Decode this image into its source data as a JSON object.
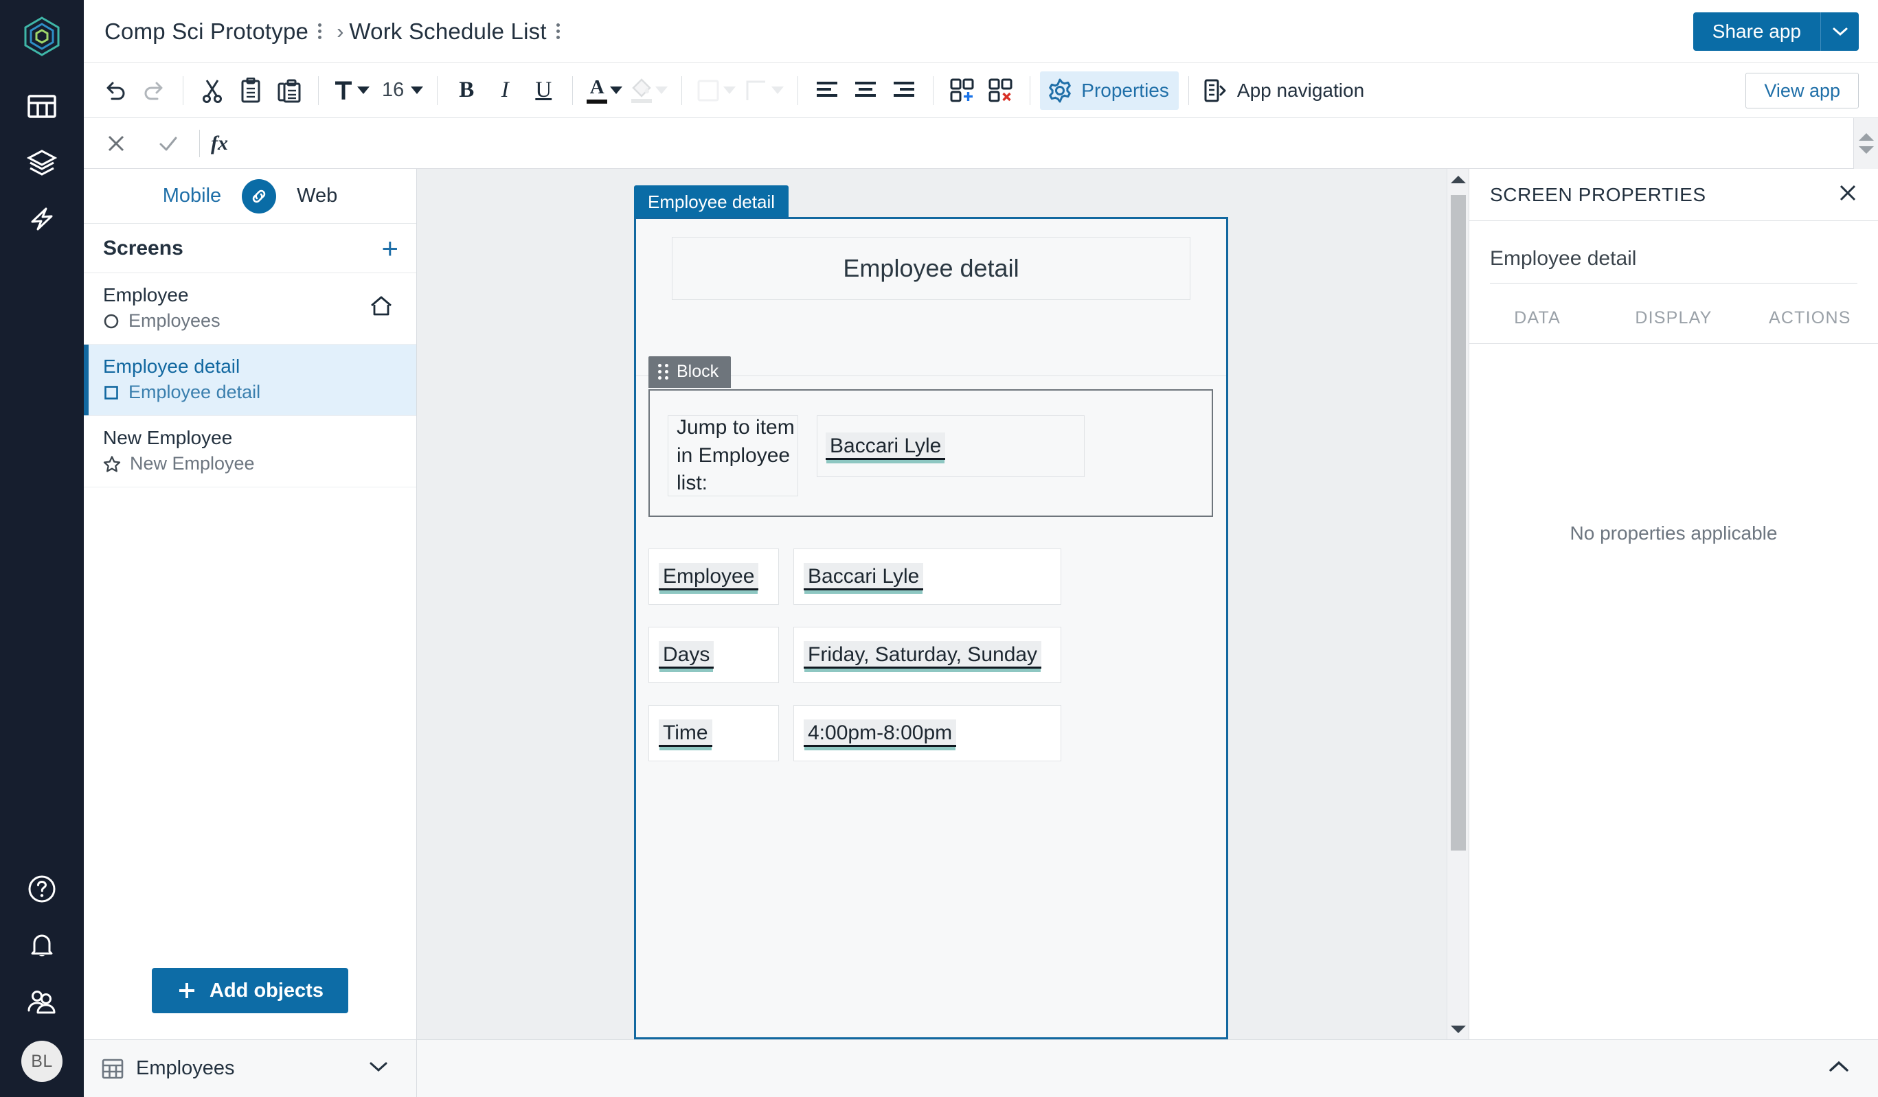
{
  "app": {
    "logo_icon": "appsheet-hex-logo"
  },
  "header": {
    "breadcrumb": [
      {
        "label": "Comp Sci Prototype",
        "menu_icon": "kebab-menu-icon"
      },
      {
        "label": "Work Schedule List",
        "menu_icon": "kebab-menu-icon"
      }
    ],
    "separator": "›",
    "share_label": "Share app",
    "share_caret_icon": "chevron-down-icon"
  },
  "rail": {
    "items": [
      {
        "name": "data",
        "icon": "table-grid-icon"
      },
      {
        "name": "app",
        "icon": "layers-stack-icon"
      },
      {
        "name": "automation",
        "icon": "lightning-bolt-icon"
      }
    ],
    "bottom_items": [
      {
        "name": "help",
        "icon": "question-circle-icon"
      },
      {
        "name": "notifications",
        "icon": "bell-icon"
      },
      {
        "name": "team",
        "icon": "users-icon"
      }
    ],
    "avatar_initials": "BL"
  },
  "toolbar": {
    "undo_icon": "undo-icon",
    "redo_icon": "redo-icon",
    "cut_icon": "scissors-icon",
    "copy_icon": "clipboard-icon",
    "paste_icon": "clipboard-paste-icon",
    "font_icon": "text-format-icon",
    "font_size": "16",
    "bold_label": "B",
    "italic_label": "I",
    "underline_label": "U",
    "text_color_label": "A",
    "fill_icon": "paint-bucket-icon",
    "shape_fill_icon": "square-fill-icon",
    "border_icon": "border-icon",
    "align_left_icon": "align-left-icon",
    "align_center_icon": "align-center-icon",
    "align_right_icon": "align-right-icon",
    "add_cells_icon": "add-cells-icon",
    "delete_cells_icon": "delete-cells-icon",
    "properties_label": "Properties",
    "properties_icon": "gear-icon",
    "app_nav_label": "App navigation",
    "app_nav_icon": "app-navigation-icon",
    "view_app_label": "View app"
  },
  "formula_bar": {
    "cancel_icon": "close-icon",
    "accept_icon": "check-icon",
    "fx_label": "fx",
    "value": "",
    "placeholder": "",
    "expand_up_icon": "triangle-up-icon",
    "expand_down_icon": "triangle-down-icon"
  },
  "left_panel": {
    "platform": {
      "mobile_label": "Mobile",
      "link_icon": "link-chain-icon",
      "web_label": "Web"
    },
    "screens_header": "Screens",
    "add_screen_icon": "plus-icon",
    "screens": [
      {
        "name": "Employee",
        "sub": "Employees",
        "sub_icon": "circle-icon",
        "selected": false,
        "home_icon": "home-icon"
      },
      {
        "name": "Employee detail",
        "sub": "Employee detail",
        "sub_icon": "square-icon",
        "selected": true,
        "home_icon": ""
      },
      {
        "name": "New Employee",
        "sub": "New Employee",
        "sub_icon": "star-icon",
        "selected": false,
        "home_icon": ""
      }
    ],
    "add_objects_label": "Add objects",
    "add_objects_icon": "plus-icon"
  },
  "canvas": {
    "screen_tab_label": "Employee detail",
    "title_text": "Employee detail",
    "block_tag_label": "Block",
    "block_grip_icon": "drag-grip-icon",
    "jump_label": "Jump to item in Employee list:",
    "jump_value": "Baccari Lyle",
    "rows": [
      {
        "label": "Employee",
        "value": "Baccari Lyle"
      },
      {
        "label": "Days",
        "value": "Friday, Saturday, Sunday"
      },
      {
        "label": "Time",
        "value": "4:00pm-8:00pm"
      }
    ],
    "scroll_up_icon": "triangle-up-icon",
    "scroll_down_icon": "triangle-down-icon"
  },
  "right_panel": {
    "title": "SCREEN PROPERTIES",
    "close_icon": "close-icon",
    "screen_name": "Employee detail",
    "tabs": [
      {
        "label": "DATA"
      },
      {
        "label": "DISPLAY"
      },
      {
        "label": "ACTIONS"
      }
    ],
    "empty_message": "No properties applicable"
  },
  "bottom_bar": {
    "table_icon": "table-grid-icon",
    "table_label": "Employees",
    "table_caret_icon": "chevron-down-icon",
    "collapse_icon": "chevron-up-icon"
  },
  "colors": {
    "brand_blue": "#0a6ca6",
    "rail_dark": "#161e2e",
    "selection_blue": "#1268a0",
    "selected_row_bg": "#e2f0fb",
    "accent_teal": "#8ec7c2",
    "block_gray": "#6e757c"
  }
}
